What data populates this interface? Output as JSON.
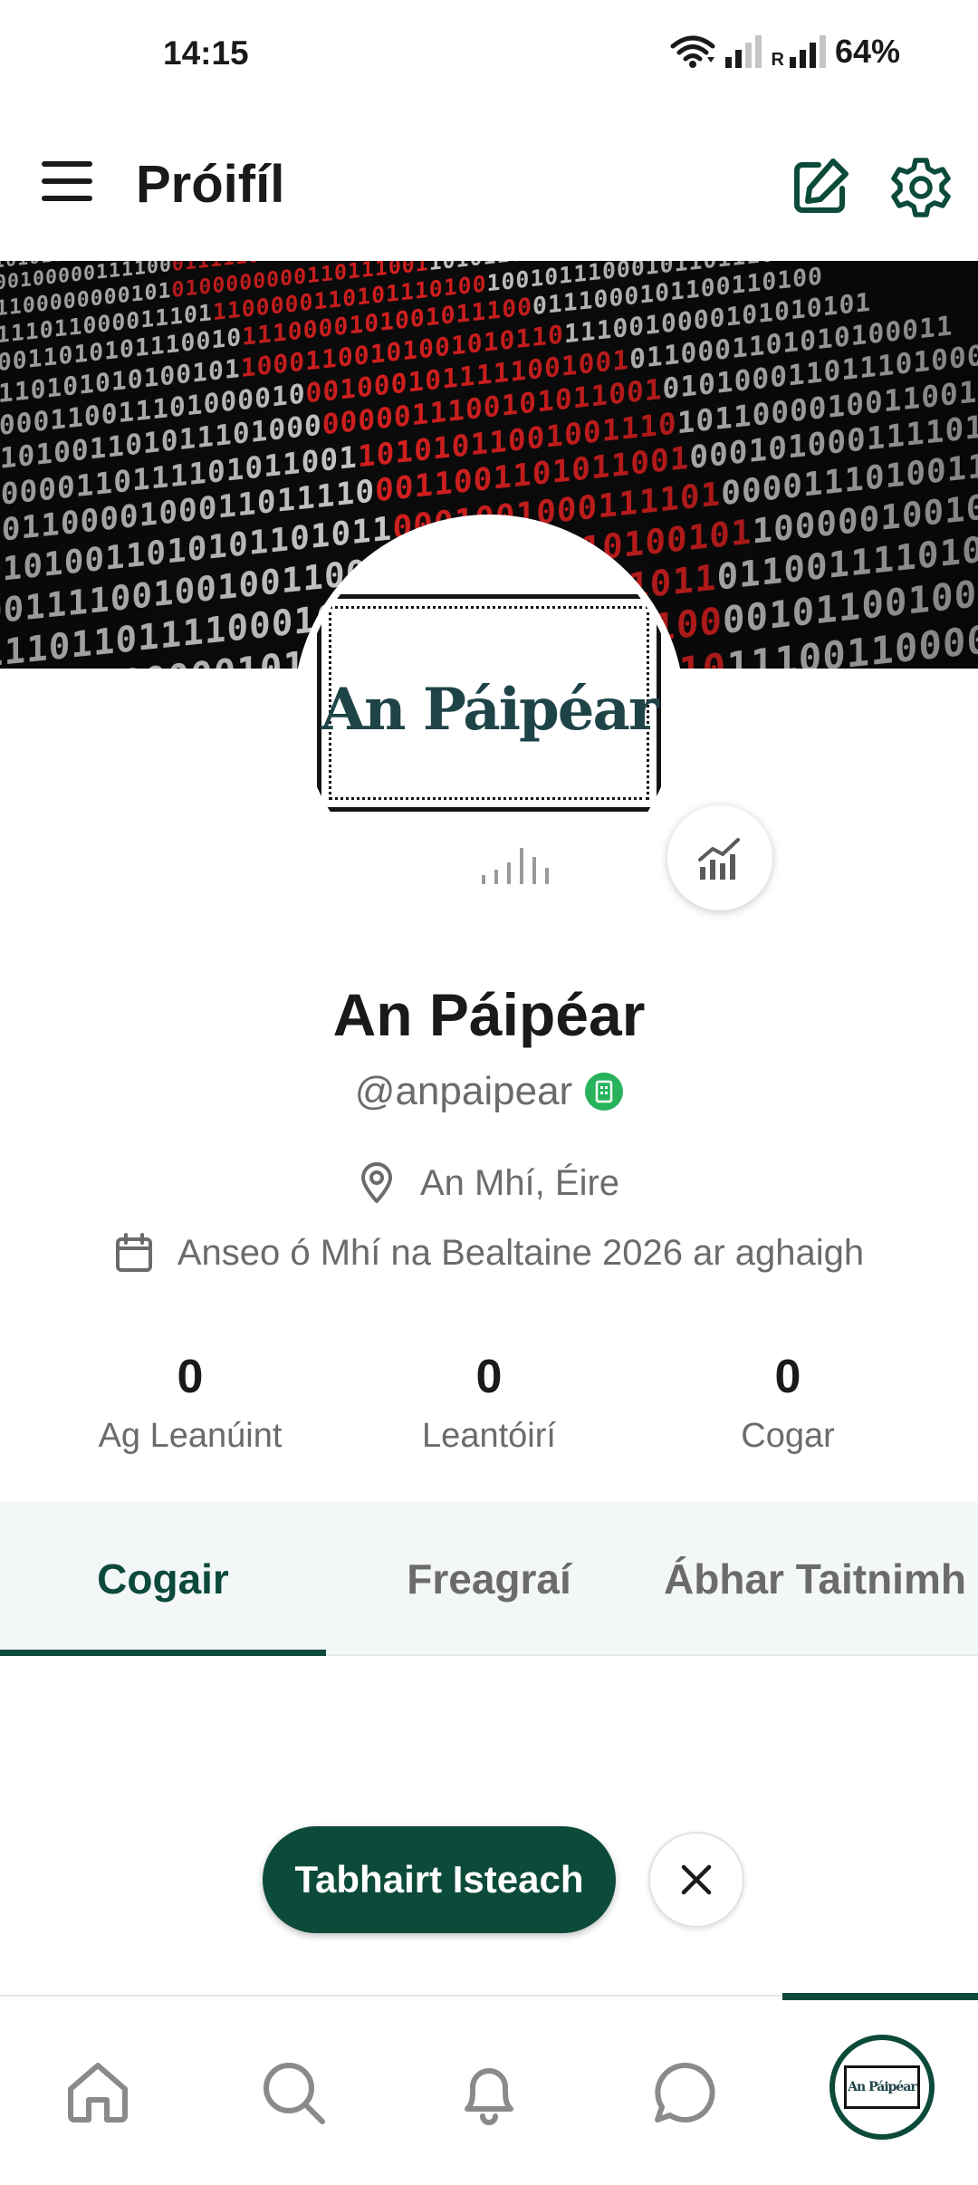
{
  "status_bar": {
    "time": "14:15",
    "battery": "64%",
    "roaming_label": "R"
  },
  "app_bar": {
    "title": "Próifíl",
    "icons": [
      "menu-icon",
      "edit-icon",
      "settings-icon"
    ]
  },
  "banner": {
    "rows": [
      {
        "a": "1101010101001",
        "b": "0101010111001101000",
        "c": "11110001011001010011"
      },
      {
        "a": "000100000111100",
        "b": "01111100101011000111",
        "c": "0011110101001011000"
      },
      {
        "a": "11100000000101",
        "b": "0100000000110111001",
        "c": "10101100110001001110"
      },
      {
        "a": "0111011000011101",
        "b": "1100000110101110100",
        "c": "10010111000101101110"
      },
      {
        "a": "10011010101110010",
        "b": "1110000101001011100",
        "c": "0111000101100110100"
      },
      {
        "a": "0110101010100101",
        "b": "10001100101001010110",
        "c": "1110010000101010101"
      },
      {
        "a": "1000110011101000010",
        "b": "0010001011111001001",
        "c": "0110001101010100011"
      },
      {
        "a": "0101001101011101000",
        "b": "0000011100101011001",
        "c": "0101000110111010000"
      },
      {
        "a": "10000110111101011001",
        "b": "10101011001001110",
        "c": "1011000010011001011"
      },
      {
        "a": "00110000100011011110",
        "b": "0011001101011001",
        "c": "0001010001111011100"
      },
      {
        "a": "11010011010101101011",
        "b": "0001001000111101",
        "c": "0000111010011100010"
      },
      {
        "a": "00111100100100110011",
        "b": "1101110110100101",
        "c": "10000010010001101101"
      },
      {
        "a": "11101101111000100000",
        "b": "0000111001011",
        "c": "01100111101011110000"
      },
      {
        "a": "01011000000101101110",
        "b": "100011101100",
        "c": "00101100100111000101"
      },
      {
        "a": "10010110110001010101",
        "b": "01001010110",
        "c": "11100110000101110011"
      },
      {
        "a": "00110111100010110111",
        "b": "110001101",
        "c": "00110011110010011010"
      }
    ],
    "colors": {
      "digit": "#c9c9c9",
      "highlight": "#d21f1f"
    }
  },
  "avatar": {
    "logo_text": "An Páipéar"
  },
  "stats_button_icon": "analytics-icon",
  "profile": {
    "name": "An Páipéar",
    "handle": "@anpaipear",
    "verified_icon": "verified-building-badge",
    "location": "An Mhí, Éire",
    "joined": "Anseo ó Mhí na Bealtaine 2026 ar aghaigh"
  },
  "stats": [
    {
      "value": "0",
      "label": "Ag Leanúint"
    },
    {
      "value": "0",
      "label": "Leantóirí"
    },
    {
      "value": "0",
      "label": "Cogar"
    }
  ],
  "tabs": [
    {
      "label": "Cogair",
      "active": true
    },
    {
      "label": "Freagraí",
      "active": false
    },
    {
      "label": "Ábhar Taitnimh",
      "active": false
    }
  ],
  "login_prompt": {
    "button_label": "Tabhairt Isteach",
    "close_icon": "close-icon"
  },
  "bottom_nav": {
    "items": [
      "home-icon",
      "search-icon",
      "bell-icon",
      "chat-icon",
      "profile-avatar"
    ],
    "active": "profile-avatar",
    "avatar_text": "An Páipéar"
  },
  "theme": {
    "accent": "#0c4a3a",
    "verified": "#27b35c",
    "muted_text": "#6b6b6b"
  }
}
